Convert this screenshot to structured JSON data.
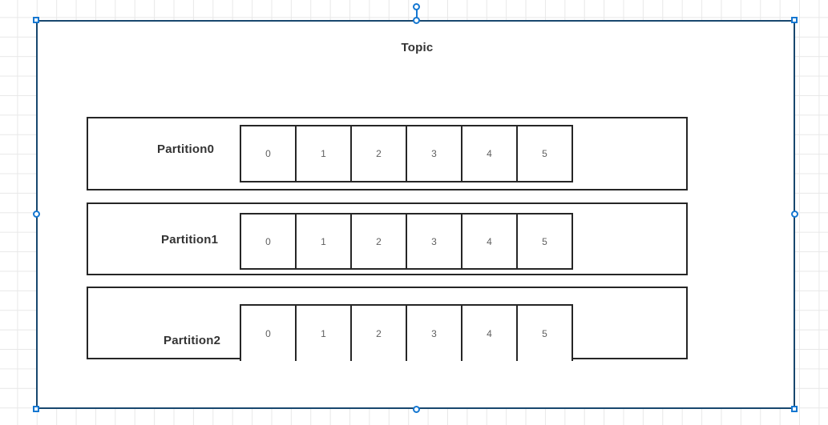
{
  "diagram": {
    "title": "Topic",
    "selected": true,
    "colors": {
      "selection_border": "#18476e",
      "handle_accent": "#1477d1",
      "shape_border": "#262626",
      "label_text": "#333333",
      "cell_text": "#5f5f5f",
      "canvas_grid": "#e8e8e8",
      "canvas_background": "#ffffff"
    },
    "partitions": [
      {
        "label": "Partition0",
        "offsets": [
          "0",
          "1",
          "2",
          "3",
          "4",
          "5"
        ]
      },
      {
        "label": "Partition1",
        "offsets": [
          "0",
          "1",
          "2",
          "3",
          "4",
          "5"
        ]
      },
      {
        "label": "Partition2",
        "offsets": [
          "0",
          "1",
          "2",
          "3",
          "4",
          "5"
        ]
      }
    ]
  },
  "selection_handles": [
    {
      "name": "rotate-handle",
      "type": "circle"
    },
    {
      "name": "handle-top-center",
      "type": "circle"
    },
    {
      "name": "handle-top-left",
      "type": "square"
    },
    {
      "name": "handle-top-right",
      "type": "square"
    },
    {
      "name": "handle-middle-left",
      "type": "circle"
    },
    {
      "name": "handle-middle-right",
      "type": "circle"
    },
    {
      "name": "handle-bottom-left",
      "type": "square"
    },
    {
      "name": "handle-bottom-center",
      "type": "circle"
    },
    {
      "name": "handle-bottom-right",
      "type": "square"
    }
  ]
}
